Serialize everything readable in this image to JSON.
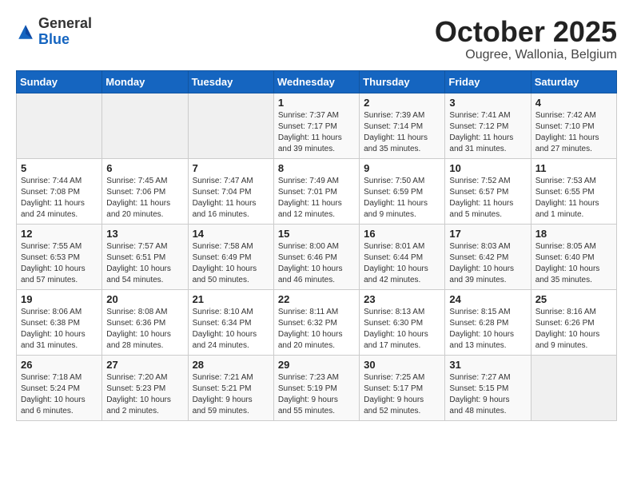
{
  "header": {
    "logo_general": "General",
    "logo_blue": "Blue",
    "month_title": "October 2025",
    "subtitle": "Ougree, Wallonia, Belgium"
  },
  "days_of_week": [
    "Sunday",
    "Monday",
    "Tuesday",
    "Wednesday",
    "Thursday",
    "Friday",
    "Saturday"
  ],
  "weeks": [
    [
      {
        "day": "",
        "info": ""
      },
      {
        "day": "",
        "info": ""
      },
      {
        "day": "",
        "info": ""
      },
      {
        "day": "1",
        "info": "Sunrise: 7:37 AM\nSunset: 7:17 PM\nDaylight: 11 hours\nand 39 minutes."
      },
      {
        "day": "2",
        "info": "Sunrise: 7:39 AM\nSunset: 7:14 PM\nDaylight: 11 hours\nand 35 minutes."
      },
      {
        "day": "3",
        "info": "Sunrise: 7:41 AM\nSunset: 7:12 PM\nDaylight: 11 hours\nand 31 minutes."
      },
      {
        "day": "4",
        "info": "Sunrise: 7:42 AM\nSunset: 7:10 PM\nDaylight: 11 hours\nand 27 minutes."
      }
    ],
    [
      {
        "day": "5",
        "info": "Sunrise: 7:44 AM\nSunset: 7:08 PM\nDaylight: 11 hours\nand 24 minutes."
      },
      {
        "day": "6",
        "info": "Sunrise: 7:45 AM\nSunset: 7:06 PM\nDaylight: 11 hours\nand 20 minutes."
      },
      {
        "day": "7",
        "info": "Sunrise: 7:47 AM\nSunset: 7:04 PM\nDaylight: 11 hours\nand 16 minutes."
      },
      {
        "day": "8",
        "info": "Sunrise: 7:49 AM\nSunset: 7:01 PM\nDaylight: 11 hours\nand 12 minutes."
      },
      {
        "day": "9",
        "info": "Sunrise: 7:50 AM\nSunset: 6:59 PM\nDaylight: 11 hours\nand 9 minutes."
      },
      {
        "day": "10",
        "info": "Sunrise: 7:52 AM\nSunset: 6:57 PM\nDaylight: 11 hours\nand 5 minutes."
      },
      {
        "day": "11",
        "info": "Sunrise: 7:53 AM\nSunset: 6:55 PM\nDaylight: 11 hours\nand 1 minute."
      }
    ],
    [
      {
        "day": "12",
        "info": "Sunrise: 7:55 AM\nSunset: 6:53 PM\nDaylight: 10 hours\nand 57 minutes."
      },
      {
        "day": "13",
        "info": "Sunrise: 7:57 AM\nSunset: 6:51 PM\nDaylight: 10 hours\nand 54 minutes."
      },
      {
        "day": "14",
        "info": "Sunrise: 7:58 AM\nSunset: 6:49 PM\nDaylight: 10 hours\nand 50 minutes."
      },
      {
        "day": "15",
        "info": "Sunrise: 8:00 AM\nSunset: 6:46 PM\nDaylight: 10 hours\nand 46 minutes."
      },
      {
        "day": "16",
        "info": "Sunrise: 8:01 AM\nSunset: 6:44 PM\nDaylight: 10 hours\nand 42 minutes."
      },
      {
        "day": "17",
        "info": "Sunrise: 8:03 AM\nSunset: 6:42 PM\nDaylight: 10 hours\nand 39 minutes."
      },
      {
        "day": "18",
        "info": "Sunrise: 8:05 AM\nSunset: 6:40 PM\nDaylight: 10 hours\nand 35 minutes."
      }
    ],
    [
      {
        "day": "19",
        "info": "Sunrise: 8:06 AM\nSunset: 6:38 PM\nDaylight: 10 hours\nand 31 minutes."
      },
      {
        "day": "20",
        "info": "Sunrise: 8:08 AM\nSunset: 6:36 PM\nDaylight: 10 hours\nand 28 minutes."
      },
      {
        "day": "21",
        "info": "Sunrise: 8:10 AM\nSunset: 6:34 PM\nDaylight: 10 hours\nand 24 minutes."
      },
      {
        "day": "22",
        "info": "Sunrise: 8:11 AM\nSunset: 6:32 PM\nDaylight: 10 hours\nand 20 minutes."
      },
      {
        "day": "23",
        "info": "Sunrise: 8:13 AM\nSunset: 6:30 PM\nDaylight: 10 hours\nand 17 minutes."
      },
      {
        "day": "24",
        "info": "Sunrise: 8:15 AM\nSunset: 6:28 PM\nDaylight: 10 hours\nand 13 minutes."
      },
      {
        "day": "25",
        "info": "Sunrise: 8:16 AM\nSunset: 6:26 PM\nDaylight: 10 hours\nand 9 minutes."
      }
    ],
    [
      {
        "day": "26",
        "info": "Sunrise: 7:18 AM\nSunset: 5:24 PM\nDaylight: 10 hours\nand 6 minutes."
      },
      {
        "day": "27",
        "info": "Sunrise: 7:20 AM\nSunset: 5:23 PM\nDaylight: 10 hours\nand 2 minutes."
      },
      {
        "day": "28",
        "info": "Sunrise: 7:21 AM\nSunset: 5:21 PM\nDaylight: 9 hours\nand 59 minutes."
      },
      {
        "day": "29",
        "info": "Sunrise: 7:23 AM\nSunset: 5:19 PM\nDaylight: 9 hours\nand 55 minutes."
      },
      {
        "day": "30",
        "info": "Sunrise: 7:25 AM\nSunset: 5:17 PM\nDaylight: 9 hours\nand 52 minutes."
      },
      {
        "day": "31",
        "info": "Sunrise: 7:27 AM\nSunset: 5:15 PM\nDaylight: 9 hours\nand 48 minutes."
      },
      {
        "day": "",
        "info": ""
      }
    ]
  ]
}
